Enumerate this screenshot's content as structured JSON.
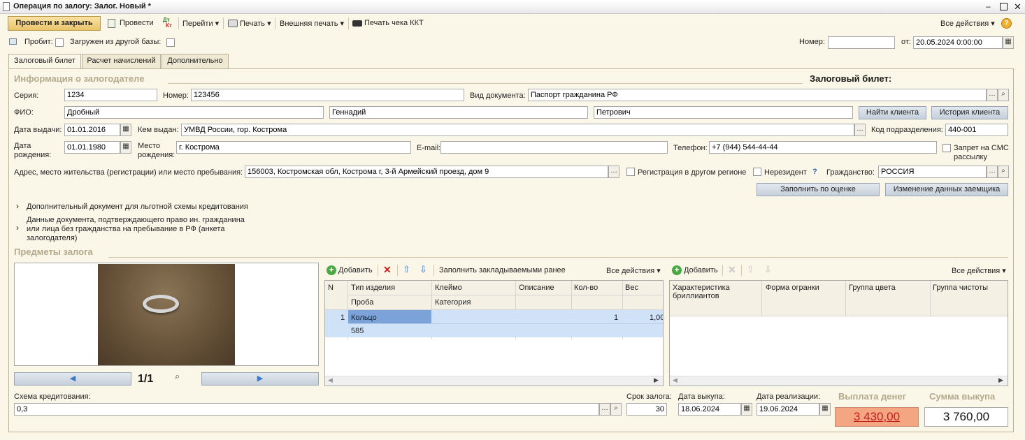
{
  "window": {
    "title": "Операция по залогу: Залог. Новый *"
  },
  "toolbar": {
    "post_close": "Провести и закрыть",
    "post": "Провести",
    "dt_kt_top": "Дт",
    "dt_kt_bottom": "Кт",
    "goto": "Перейти",
    "print": "Печать",
    "ext_print": "Внешняя печать",
    "kkt_print": "Печать чека ККТ",
    "all_actions": "Все действия"
  },
  "header": {
    "probit_label": "Пробит:",
    "loaded_label": "Загружен из другой базы:",
    "number_label": "Номер:",
    "number_value": "",
    "from_label": "от:",
    "date_value": "20.05.2024  0:00:00"
  },
  "tabs": [
    "Залоговый билет",
    "Расчет начислений",
    "Дополнительно"
  ],
  "pledgor": {
    "section_title": "Информация о залогодателе",
    "ticket_title": "Залоговый билет:",
    "series_label": "Серия:",
    "series_value": "1234",
    "num_label": "Номер:",
    "num_value": "123456",
    "doctype_label": "Вид документа:",
    "doctype_value": "Паспорт гражданина РФ",
    "fio_label": "ФИО:",
    "last_name": "Дробный",
    "first_name": "Геннадий",
    "patronymic": "Петрович",
    "find_client": "Найти клиента",
    "client_history": "История клиента",
    "issue_date_label": "Дата выдачи:",
    "issue_date": "01.01.2016",
    "issued_by_label": "Кем выдан:",
    "issued_by": "УМВД России, гор. Кострома",
    "dept_code_label": "Код подразделения:",
    "dept_code": "440-001",
    "birth_date_label_1": "Дата",
    "birth_date_label_2": "рождения:",
    "birth_date": "01.01.1980",
    "birth_place_label_1": "Место",
    "birth_place_label_2": "рождения:",
    "birth_place": "г. Кострома",
    "email_label": "E-mail:",
    "email": "",
    "phone_label": "Телефон:",
    "phone": "+7 (944) 544-44-44",
    "sms_ban_1": "Запрет на СМС",
    "sms_ban_2": "рассылку",
    "address_label": "Адрес, место жительства (регистрации) или место пребывания:",
    "address": "156003, Костромская обл, Кострома г, 3-й Армейский проезд, дом 9",
    "other_region": "Регистрация в другом регионе",
    "nonresident": "Нерезидент",
    "question": "?",
    "citizenship_label": "Гражданство:",
    "citizenship": "РОССИЯ",
    "fill_by_eval": "Заполнить по оценке",
    "change_borrower": "Изменение данных заемщика",
    "extra_doc": "Дополнительный документ для льготной схемы кредитования",
    "foreign_doc_1": "Данные документа, подтверждающего право ин. гражданина",
    "foreign_doc_2": "или лица без гражданства на пребывание в РФ (анкета",
    "foreign_doc_3": "залогодателя)"
  },
  "items": {
    "section_title": "Предметы залога",
    "counter": "1/1",
    "add": "Добавить",
    "fill_prev": "Заполнить закладываемыми ранее",
    "all_actions": "Все действия",
    "columns": {
      "n": "N",
      "type": "Тип изделия",
      "hallmark": "Клеймо",
      "desc": "Описание",
      "qty": "Кол-во",
      "weight": "Вес",
      "probe": "Проба",
      "category": "Категория"
    },
    "rows": [
      {
        "n": "1",
        "type": "Кольцо",
        "hallmark": "",
        "desc": "",
        "qty": "1",
        "weight": "1,00",
        "probe": "585",
        "category": ""
      }
    ]
  },
  "diamonds": {
    "add": "Добавить",
    "all_actions": "Все действия",
    "columns": [
      "Характеристика бриллиантов",
      "Форма огранки",
      "Группа цвета",
      "Группа чистоты"
    ]
  },
  "footer": {
    "scheme_label": "Схема кредитования:",
    "scheme": "0,3",
    "term_label": "Срок залога:",
    "term": "30",
    "buyout_date_label": "Дата выкупа:",
    "buyout_date": "18.06.2024",
    "sale_date_label": "Дата реализации:",
    "sale_date": "19.06.2024",
    "payout_label": "Выплата денег",
    "payout": "3 430,00",
    "buyout_sum_label": "Сумма выкупа",
    "buyout_sum": "3 760,00"
  },
  "colors": {
    "accent": "#f4a582",
    "selection": "#cfe2f7",
    "selected_cell": "#7ba3d9",
    "background": "#fbf7e8"
  }
}
